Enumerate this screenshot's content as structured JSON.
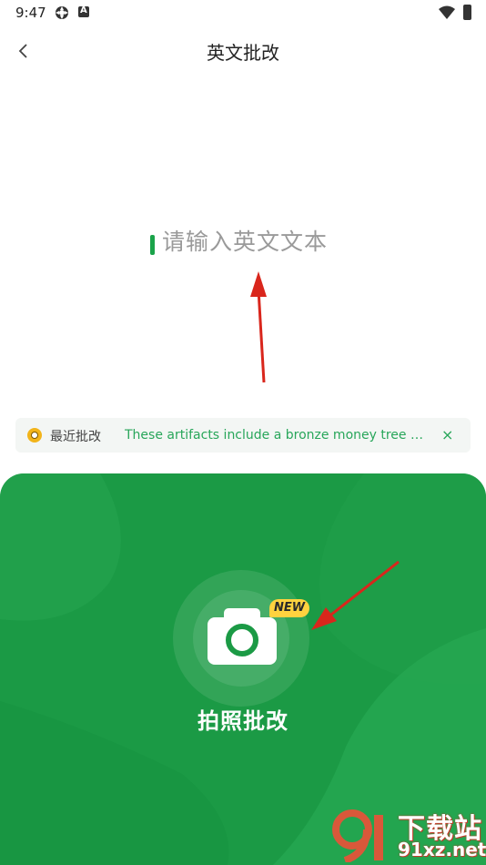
{
  "status_bar": {
    "time": "9:47"
  },
  "header": {
    "title": "英文批改",
    "back_icon": "chevron-left-icon"
  },
  "editor": {
    "placeholder": "请输入英文文本"
  },
  "recent": {
    "label": "最近批改",
    "text": "These artifacts include a bronze money tree wi...",
    "close": "×"
  },
  "camera": {
    "badge": "NEW",
    "label": "拍照批改",
    "icon": "camera-icon"
  },
  "watermark": {
    "title": "下载站",
    "url": "91xz.net"
  },
  "colors": {
    "accent": "#1b9a45",
    "badge": "#ffd23f",
    "link": "#28a65a",
    "annotation_arrow": "#d9261c"
  }
}
